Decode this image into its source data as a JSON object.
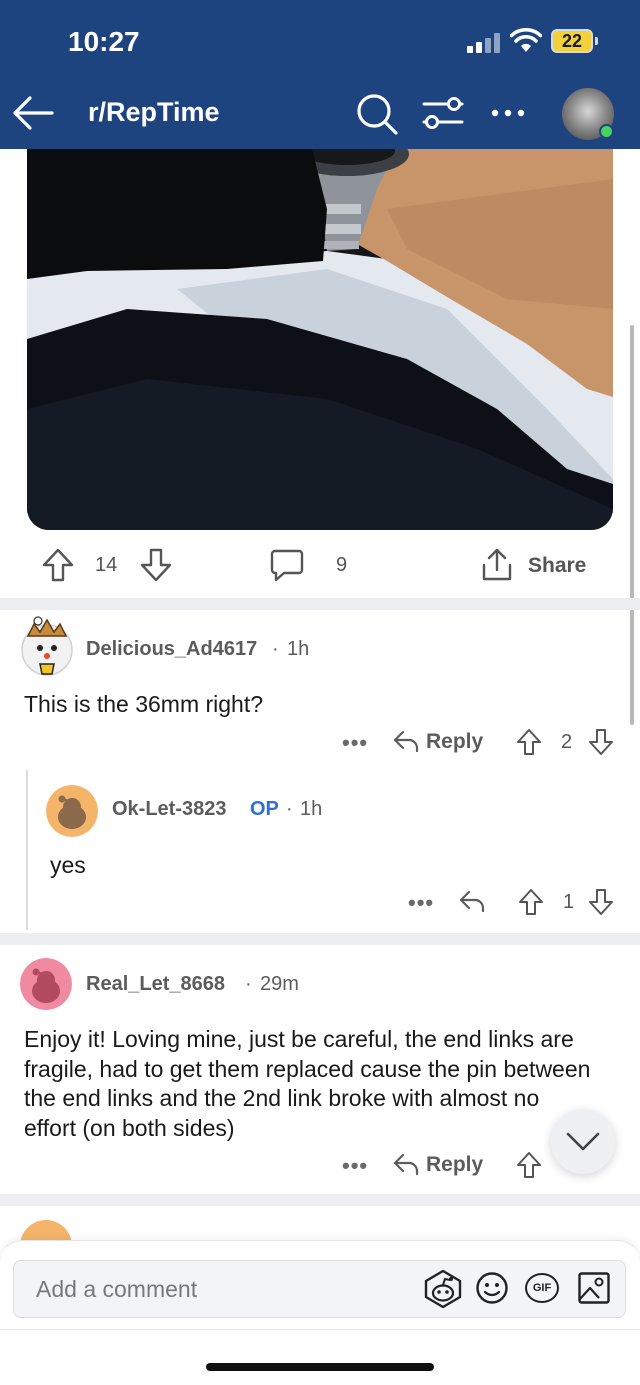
{
  "status_bar": {
    "time": "10:27",
    "battery": "22"
  },
  "header": {
    "subreddit": "r/RepTime"
  },
  "post": {
    "votes": "14",
    "comments": "9",
    "share_label": "Share"
  },
  "comments": [
    {
      "username": "Delicious_Ad4617",
      "time": "1h",
      "body": "This is the 36mm right?",
      "reply_label": "Reply",
      "votes": "2",
      "replies": [
        {
          "username": "Ok-Let-3823",
          "op_badge": "OP",
          "time": "1h",
          "body": "yes",
          "votes": "1"
        }
      ]
    },
    {
      "username": "Real_Let_8668",
      "time": "29m",
      "body": "Enjoy it! Loving mine, just be careful, the end links are fragile, had to get them replaced cause the pin between the end links and the 2nd link broke with almost no effort (on both sides)",
      "reply_label": "Reply"
    }
  ],
  "composer": {
    "placeholder": "Add a comment",
    "gif_label": "GIF"
  },
  "separator": "·",
  "more_dots": "•••",
  "colors": {
    "header": "#1e4480",
    "op_blue": "#2e6fd6",
    "online": "#46d160",
    "battery": "#f2d13d"
  }
}
